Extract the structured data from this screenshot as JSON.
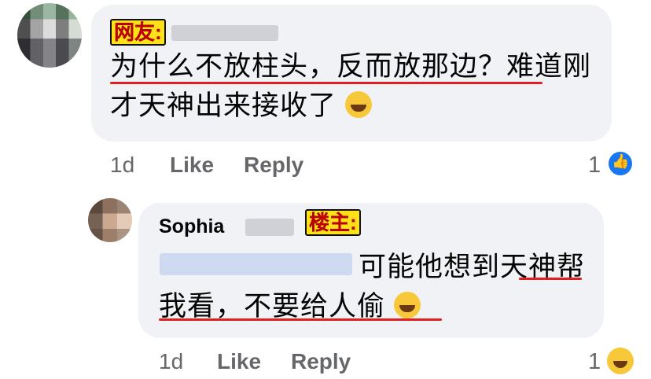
{
  "comment": {
    "tag": "网友:",
    "text": "为什么不放柱头，反而放那边？难道刚才天神出来接收了",
    "time": "1d",
    "like": "Like",
    "reply": "Reply",
    "reaction_count": "1",
    "reaction": "like-icon"
  },
  "reply_comment": {
    "author": "Sophia",
    "tag": "楼主:",
    "text": "可能他想到天神帮我看，不要给人偷",
    "time": "1d",
    "like": "Like",
    "reply": "Reply",
    "reaction_count": "1",
    "reaction": "haha-icon"
  },
  "colors": {
    "bubble": "#f0f2f5",
    "tag_bg": "#ffe11a",
    "tag_text": "#c00000",
    "underline": "#e02020",
    "meta": "#65676b",
    "like_blue": "#1877f2"
  }
}
